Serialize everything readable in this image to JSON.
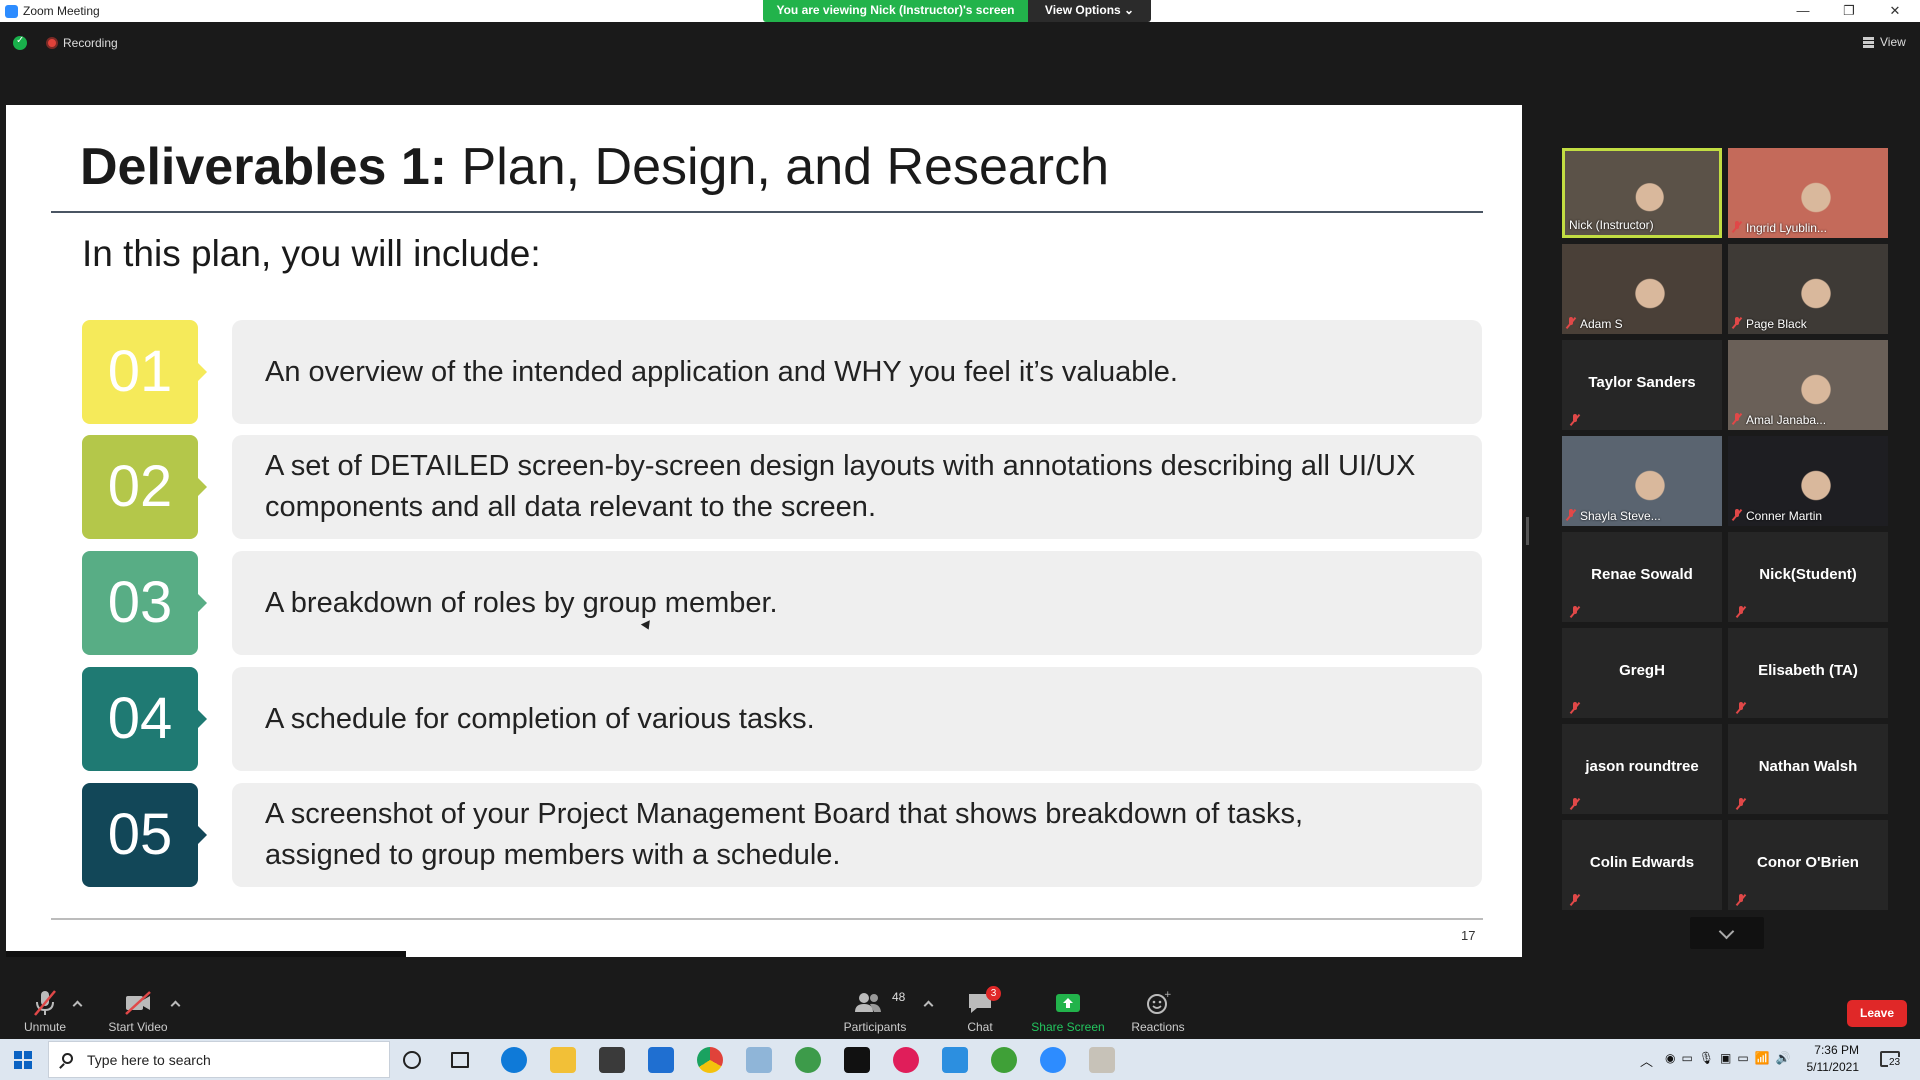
{
  "window": {
    "title": "Zoom Meeting",
    "viewing_banner": "You are viewing Nick (Instructor)'s screen",
    "view_options": "View Options ⌄",
    "minimize": "—",
    "restore": "❐",
    "close": "✕"
  },
  "status": {
    "recording_label": "Recording",
    "view_label": "View"
  },
  "slide": {
    "title_bold": "Deliverables 1:",
    "title_rest": " Plan, Design, and Research",
    "subtitle": "In this plan, you will include:",
    "page_number": "17",
    "items": [
      {
        "number": "01",
        "text": "An overview of the intended application and WHY you feel it’s valuable.",
        "color": "#f5ea5a"
      },
      {
        "number": "02",
        "text": "A set of DETAILED screen-by-screen design layouts with annotations describing all UI/UX components and all data relevant to the screen.",
        "color": "#b4c74a"
      },
      {
        "number": "03",
        "text": "A breakdown of roles by group member.",
        "color": "#58ad85"
      },
      {
        "number": "04",
        "text": "A schedule for completion of various tasks.",
        "color": "#1f7a73"
      },
      {
        "number": "05",
        "text": "A screenshot of your Project Management Board that shows breakdown of tasks, assigned to group members with a schedule.",
        "color": "#124758"
      }
    ]
  },
  "participants": [
    {
      "name": "Nick (Instructor)",
      "video": true,
      "muted": false
    },
    {
      "name": "Ingrid Lyublin...",
      "video": true,
      "muted": true
    },
    {
      "name": "Adam S",
      "video": true,
      "muted": true
    },
    {
      "name": "Page Black",
      "video": true,
      "muted": true
    },
    {
      "name": "Taylor Sanders",
      "video": false,
      "muted": true
    },
    {
      "name": "Amal Janaba...",
      "video": true,
      "muted": true
    },
    {
      "name": "Shayla Steve...",
      "video": true,
      "muted": true
    },
    {
      "name": "Conner Martin",
      "video": true,
      "muted": true
    },
    {
      "name": "Renae Sowald",
      "video": false,
      "muted": true
    },
    {
      "name": "Nick(Student)",
      "video": false,
      "muted": true
    },
    {
      "name": "GregH",
      "video": false,
      "muted": true
    },
    {
      "name": "Elisabeth (TA)",
      "video": false,
      "muted": true
    },
    {
      "name": "jason roundtree",
      "video": false,
      "muted": true
    },
    {
      "name": "Nathan Walsh",
      "video": false,
      "muted": true
    },
    {
      "name": "Colin Edwards",
      "video": false,
      "muted": true
    },
    {
      "name": "Conor O'Brien",
      "video": false,
      "muted": true
    }
  ],
  "controls": {
    "unmute": "Unmute",
    "start_video": "Start Video",
    "participants": "Participants",
    "participants_count": "48",
    "chat": "Chat",
    "chat_badge": "3",
    "share_screen": "Share Screen",
    "reactions": "Reactions",
    "leave": "Leave"
  },
  "taskbar": {
    "search_placeholder": "Type here to search",
    "time": "7:36 PM",
    "date": "5/11/2021",
    "notification_count": "23"
  }
}
